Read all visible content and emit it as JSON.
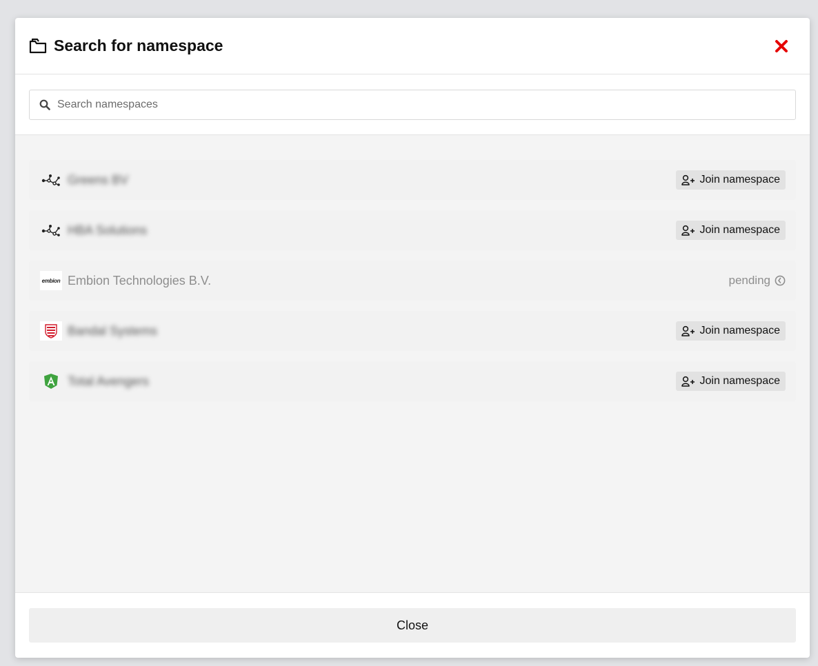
{
  "modal": {
    "title": "Search for namespace",
    "title_icon": "folder-icon",
    "close_icon": "close-x-icon",
    "accent_close_color": "#e60000"
  },
  "search": {
    "placeholder": "Search namespaces",
    "value": "",
    "icon": "search-icon"
  },
  "namespaces": [
    {
      "name": "Greens BV",
      "logo": "network-icon",
      "status": "joinable",
      "action_label": "Join namespace",
      "blurred": true
    },
    {
      "name": "HBA Solutions",
      "logo": "network-icon",
      "status": "joinable",
      "action_label": "Join namespace",
      "blurred": true
    },
    {
      "name": "Embion Technologies B.V.",
      "logo": "embion-logo",
      "logo_text": "embion",
      "status": "pending",
      "status_label": "pending",
      "blurred": false
    },
    {
      "name": "Bandal Systems",
      "logo": "shield-logo",
      "status": "joinable",
      "action_label": "Join namespace",
      "blurred": true
    },
    {
      "name": "Total Avengers",
      "logo": "angular-logo",
      "status": "joinable",
      "action_label": "Join namespace",
      "blurred": true
    }
  ],
  "footer": {
    "close_label": "Close"
  }
}
